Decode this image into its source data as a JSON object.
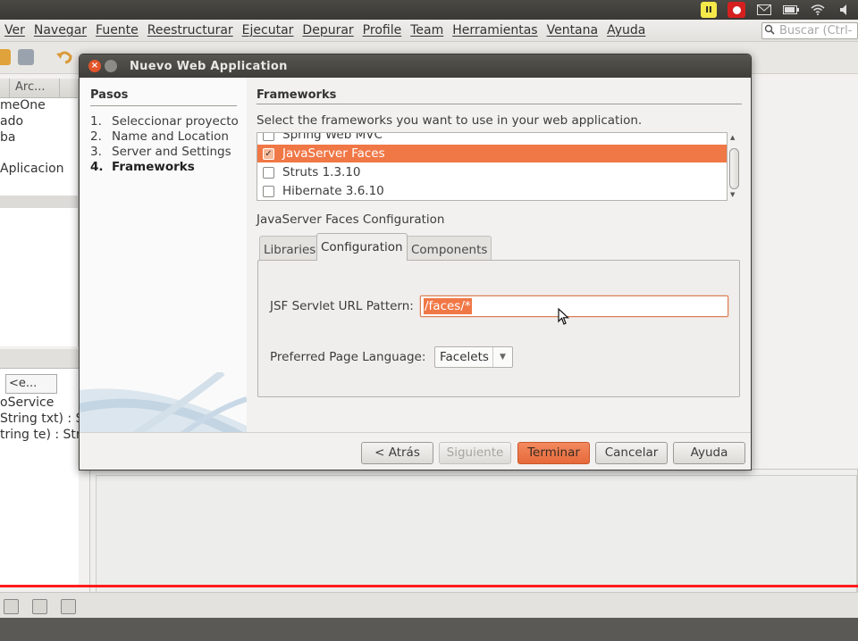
{
  "menubar": {
    "items": [
      "Ver",
      "Navegar",
      "Fuente",
      "Reestructurar",
      "Ejecutar",
      "Depurar",
      "Profile",
      "Team",
      "Herramientas",
      "Ventana",
      "Ayuda"
    ],
    "search_placeholder": "Buscar (Ctrl-"
  },
  "sys_panel": {
    "icons": [
      "pause-recording-icon",
      "stop-recording-icon",
      "mail-icon",
      "battery-icon",
      "wifi-icon",
      "volume-icon"
    ],
    "pause_glyph": "II"
  },
  "projects_panel": {
    "tab_label": "Arc...",
    "lines": [
      "meOne",
      "ado",
      "ba",
      "Aplicacion"
    ]
  },
  "navigator_panel": {
    "combo_value": "<e...",
    "lines": [
      "oService",
      "String txt) : Str",
      "tring te) : Strin"
    ]
  },
  "dialog": {
    "title": "Nuevo  Web Application",
    "close_glyph": "×",
    "steps_heading": "Pasos",
    "steps": [
      {
        "num": "1.",
        "label": "Seleccionar proyecto"
      },
      {
        "num": "2.",
        "label": "Name and Location"
      },
      {
        "num": "3.",
        "label": "Server and Settings"
      },
      {
        "num": "4.",
        "label": "Frameworks"
      }
    ],
    "section_heading": "Frameworks",
    "section_description": "Select the frameworks you want to use in your web application.",
    "frameworks": [
      {
        "name": "Spring Web MVC",
        "checked": false,
        "selected": false
      },
      {
        "name": "JavaServer Faces",
        "checked": true,
        "selected": true
      },
      {
        "name": "Struts 1.3.10",
        "checked": false,
        "selected": false
      },
      {
        "name": "Hibernate 3.6.10",
        "checked": false,
        "selected": false
      }
    ],
    "check_glyph": "✓",
    "config_title": "JavaServer Faces Configuration",
    "tabs": [
      "Libraries",
      "Configuration",
      "Components"
    ],
    "active_tab": "Configuration",
    "url_pattern_label": "JSF Servlet URL Pattern:",
    "url_pattern_value": "/faces/*",
    "page_language_label": "Preferred Page Language:",
    "page_language_value": "Facelets",
    "buttons": {
      "back": "< Atrás",
      "next": "Siguiente >",
      "finish": "Terminar",
      "cancel": "Cancelar",
      "help": "Ayuda"
    },
    "accent_color": "#f07746"
  }
}
